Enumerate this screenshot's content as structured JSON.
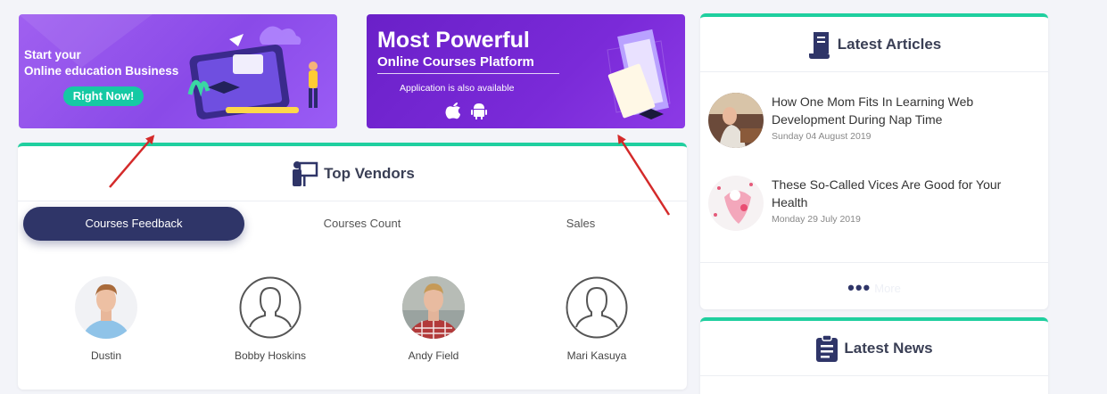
{
  "banners": {
    "left": {
      "line1": "Start your",
      "line2": "Online education Business",
      "button": "Right Now!"
    },
    "right": {
      "title": "Most Powerful",
      "subtitle": "Online Courses Platform",
      "small": "Application is also available"
    }
  },
  "vendors": {
    "title": "Top Vendors",
    "tabs": [
      "Courses Feedback",
      "Courses Count",
      "Sales"
    ],
    "active_tab": "Courses Feedback",
    "people": [
      {
        "name": "Dustin",
        "avatar": "photo"
      },
      {
        "name": "Bobby Hoskins",
        "avatar": "placeholder-user-icon"
      },
      {
        "name": "Andy Field",
        "avatar": "photo"
      },
      {
        "name": "Mari Kasuya",
        "avatar": "placeholder-user-icon"
      }
    ]
  },
  "articles": {
    "title": "Latest Articles",
    "items": [
      {
        "title": "How One Mom Fits In Learning Web Development During Nap Time",
        "date": "Sunday 04 August 2019"
      },
      {
        "title": "These So-Called Vices Are Good for Your Health",
        "date": "Monday 29 July 2019"
      }
    ],
    "more_label": "More"
  },
  "news": {
    "title": "Latest News"
  },
  "colors": {
    "accent": "#1fcf9f",
    "primary": "#2f3568",
    "annotation_arrow": "#d42a2a"
  }
}
